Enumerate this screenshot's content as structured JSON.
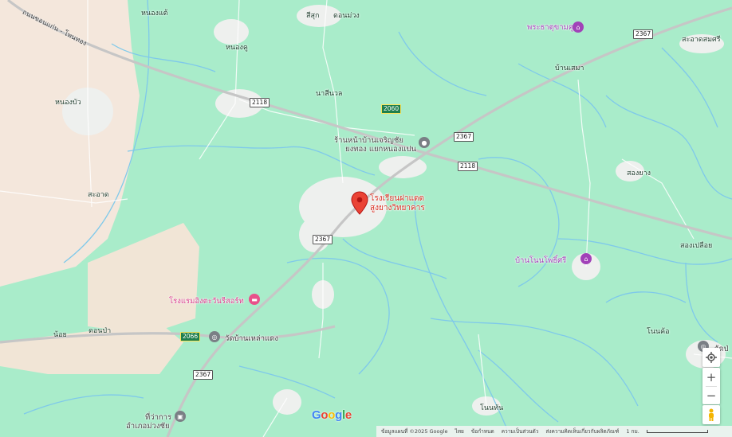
{
  "map": {
    "selected_place": {
      "line1": "โรงเรียนฝาแดด",
      "line2": "สูงยางวิทยาคาร"
    },
    "places": [
      {
        "id": "nongdaeng",
        "text": "หนองแต้"
      },
      {
        "id": "sisuk",
        "text": "สีสุก"
      },
      {
        "id": "donmuang",
        "text": "ดอนม่วง"
      },
      {
        "id": "nongku",
        "text": "หนองคู"
      },
      {
        "id": "nasinuan",
        "text": "นาสีนวล"
      },
      {
        "id": "nongbua",
        "text": "หนองบัว"
      },
      {
        "id": "saat",
        "text": "สะอาด"
      },
      {
        "id": "banlao",
        "text": "บ้านเสมา"
      },
      {
        "id": "saatsomsri",
        "text": "สะอาดสมศรี"
      },
      {
        "id": "songyang",
        "text": "สองยาง"
      },
      {
        "id": "songpluai",
        "text": "สองเปลือย"
      },
      {
        "id": "nonkhong",
        "text": "โนนค้อ"
      },
      {
        "id": "noi",
        "text": "น้อย"
      },
      {
        "id": "donpa",
        "text": "ดอนป่า"
      },
      {
        "id": "nonthon",
        "text": "โนนทัน"
      },
      {
        "id": "roadname",
        "text": "ถนนขอนแก่น - โพนทอง"
      }
    ],
    "pois": [
      {
        "id": "phrathat",
        "text": "พระธาตุขามคู"
      },
      {
        "id": "shop",
        "text": "ร้านหน้าบ้านเจริญชัย"
      },
      {
        "id": "shop2",
        "text": "ยงทอง แยกหนองแปน"
      },
      {
        "id": "banmon",
        "text": "บ้านโนนโพธิ์ศรี"
      },
      {
        "id": "hotel",
        "text": "โรงแรมอิงตะวันรีสอร์ท"
      },
      {
        "id": "watban",
        "text": "วัดบ้านเหล่าแดง"
      },
      {
        "id": "amphoe",
        "text": "ที่ว่าการ"
      },
      {
        "id": "amphoe2",
        "text": "อำเภอม่วงชัย"
      },
      {
        "id": "watright",
        "text": "วัดป่"
      }
    ],
    "route_shields": [
      {
        "id": "r2118a",
        "text": "2118"
      },
      {
        "id": "r2060",
        "text": "2060"
      },
      {
        "id": "r2367a",
        "text": "2367"
      },
      {
        "id": "r2118b",
        "text": "2118"
      },
      {
        "id": "r2367b",
        "text": "2367"
      },
      {
        "id": "r2367c",
        "text": "2367"
      },
      {
        "id": "r2367d",
        "text": "2367"
      },
      {
        "id": "r2066",
        "text": "2066"
      }
    ]
  },
  "branding": {
    "google_letters": [
      {
        "ch": "G",
        "color": "#4285F4"
      },
      {
        "ch": "o",
        "color": "#EA4335"
      },
      {
        "ch": "o",
        "color": "#FBBC05"
      },
      {
        "ch": "g",
        "color": "#4285F4"
      },
      {
        "ch": "l",
        "color": "#34A853"
      },
      {
        "ch": "e",
        "color": "#EA4335"
      }
    ]
  },
  "footer": {
    "map_data": "ข้อมูลแผนที่ ©2025 Google",
    "thai": "ไทย",
    "terms": "ข้อกำหนด",
    "privacy": "ความเป็นส่วนตัว",
    "feedback": "ส่งความคิดเห็นเกี่ยวกับผลิตภัณฑ์",
    "scale": "1 กม."
  },
  "controls": {
    "locate_icon": "my-location-icon",
    "zoom_in": "+",
    "zoom_out": "−",
    "pegman_icon": "street-view-pegman-icon"
  },
  "colors": {
    "water": "#a9ecca",
    "land": "#c5e8c4",
    "urban": "#eef0ee",
    "arid": "#f4e7dc",
    "river": "#7fc9ea",
    "road": "#d0d0d0",
    "pin": "#ea4335"
  }
}
